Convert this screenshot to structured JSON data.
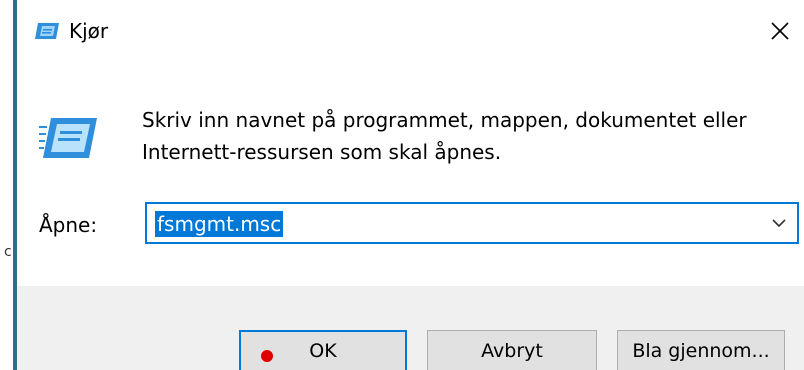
{
  "window": {
    "title": "Kjør",
    "close_icon": "close-icon",
    "title_icon": "run-icon"
  },
  "content": {
    "icon": "run-icon",
    "description": "Skriv inn navnet på programmet, mappen, dokumentet eller Internett-ressursen som skal åpnes.",
    "open_label": "Åpne:",
    "open_value": "fsmgmt.msc",
    "dropdown_icon": "chevron-down-icon"
  },
  "buttons": {
    "ok": "OK",
    "cancel": "Avbryt",
    "browse": "Bla gjennom..."
  },
  "colors": {
    "accent": "#0078d7",
    "footer_bg": "#f0f0f0",
    "cursor_marker": "#e00000"
  }
}
